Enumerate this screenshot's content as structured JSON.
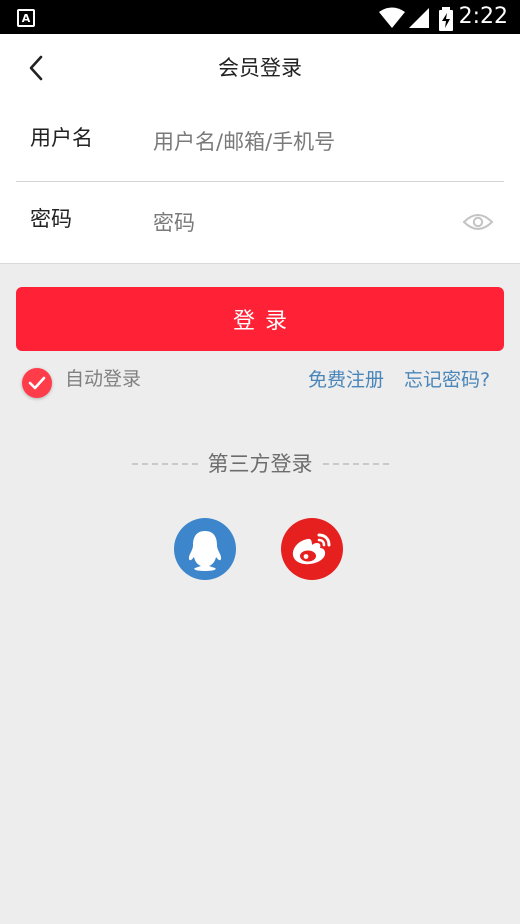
{
  "status_bar": {
    "app_badge": "A",
    "time": "2:22",
    "icons": [
      "wifi-icon",
      "cell-signal-icon",
      "battery-charging-icon"
    ]
  },
  "header": {
    "title": "会员登录",
    "back_icon": "chevron-left-icon"
  },
  "form": {
    "username": {
      "label": "用户名",
      "placeholder": "用户名/邮箱/手机号",
      "value": ""
    },
    "password": {
      "label": "密码",
      "placeholder": "密码",
      "value": "",
      "toggle_icon": "eye-icon"
    }
  },
  "actions": {
    "login_label": "登录",
    "auto_login_label": "自动登录",
    "auto_login_checked": true,
    "register_link": "免费注册",
    "forgot_link": "忘记密码?"
  },
  "third_party": {
    "title": "第三方登录",
    "providers": [
      {
        "icon": "qq-icon",
        "color": "#3e86cb"
      },
      {
        "icon": "weibo-icon",
        "color": "#e61f1f"
      }
    ]
  },
  "colors": {
    "primary": "#ff2236",
    "link": "#4a86b9",
    "background": "#ededed"
  }
}
